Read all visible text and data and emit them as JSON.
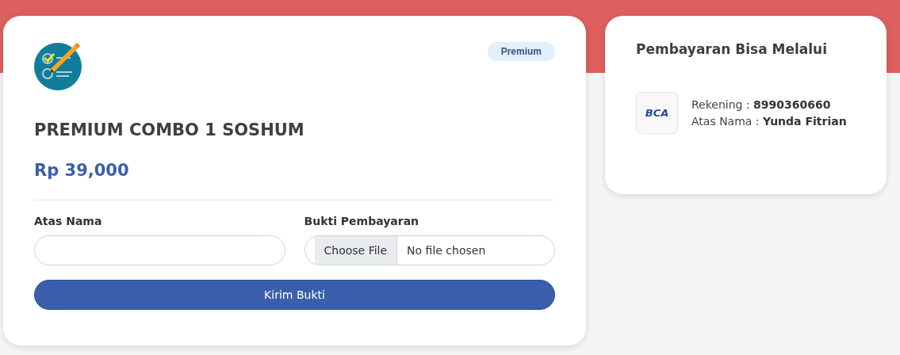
{
  "product": {
    "badge": "Premium",
    "title": "PREMIUM COMBO 1 SOSHUM",
    "price": "Rp 39,000"
  },
  "form": {
    "name_label": "Atas Nama",
    "file_label": "Bukti Pembayaran",
    "file_button": "Choose File",
    "file_status": "No file chosen",
    "submit": "Kirim Bukti"
  },
  "payment": {
    "title": "Pembayaran Bisa Melalui",
    "bank_logo": "BCA",
    "account_label": "Rekening : ",
    "account": "8990360660",
    "holder_label": "Atas Nama : ",
    "holder": "Yunda Fitrian"
  }
}
